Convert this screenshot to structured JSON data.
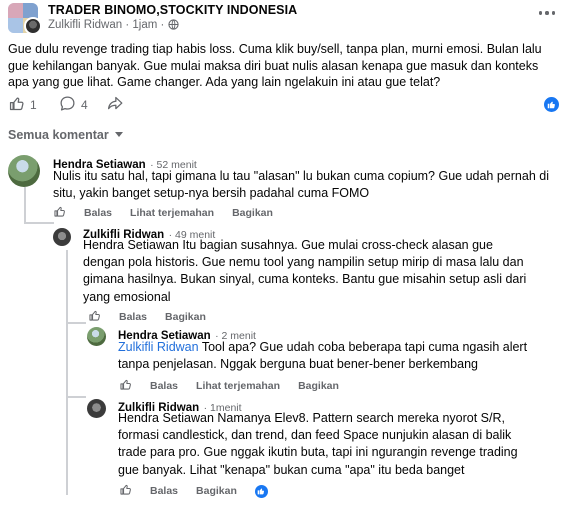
{
  "post": {
    "group_name": "TRADER BINOMO,STOCKITY INDONESIA",
    "author": "Zulkifli Ridwan",
    "time": "1jam",
    "separator": "·",
    "body": "Gue dulu revenge trading tiap habis loss. Cuma klik buy/sell, tanpa plan, murni emosi. Bulan lalu gue kehilangan banyak. Gue mulai maksa diri buat nulis alasan kenapa gue masuk dan konteks apa yang gue lihat. Game changer. Ada yang lain ngelakuin ini atau gue telat?",
    "like_count": "1",
    "comment_count": "4",
    "reaction_color": "#1877f2"
  },
  "comments_sort": "Semua komentar",
  "comments": [
    {
      "name": "Hendra Setiawan",
      "time": "52 menit",
      "text": "Nulis itu satu hal, tapi gimana lu tau \"alasan\" lu bukan cuma copium? Gue udah pernah di situ, yakin banget setup-nya bersih padahal cuma FOMO",
      "reply": "Balas",
      "translate": "Lihat terjemahan",
      "share": "Bagikan"
    },
    {
      "name": "Zulkifli Ridwan",
      "time": "49 menit",
      "text": "Hendra Setiawan Itu bagian susahnya. Gue mulai cross-check alasan gue dengan pola historis. Gue nemu tool yang nampilin setup mirip di masa lalu dan gimana hasilnya. Bukan sinyal, cuma konteks. Bantu gue misahin setup asli dari yang emosional",
      "reply": "Balas",
      "share": "Bagikan"
    },
    {
      "name": "Hendra Setiawan",
      "time": "2 menit",
      "mention": "Zulkifli Ridwan",
      "text": " Tool apa? Gue udah coba beberapa tapi cuma ngasih alert tanpa penjelasan. Nggak berguna buat bener-bener berkembang",
      "reply": "Balas",
      "translate": "Lihat terjemahan",
      "share": "Bagikan"
    },
    {
      "name": "Zulkifli Ridwan",
      "time": "1menit",
      "text": "Hendra Setiawan Namanya Elev8. Pattern search mereka nyorot S/R, formasi candlestick, dan trend, dan feed Space nunjukin alasan di balik trade para pro. Gue nggak ikutin buta, tapi ini ngurangin revenge trading gue banyak. Lihat \"kenapa\" bukan cuma \"apa\" itu beda banget",
      "reply": "Balas",
      "share": "Bagikan"
    }
  ]
}
